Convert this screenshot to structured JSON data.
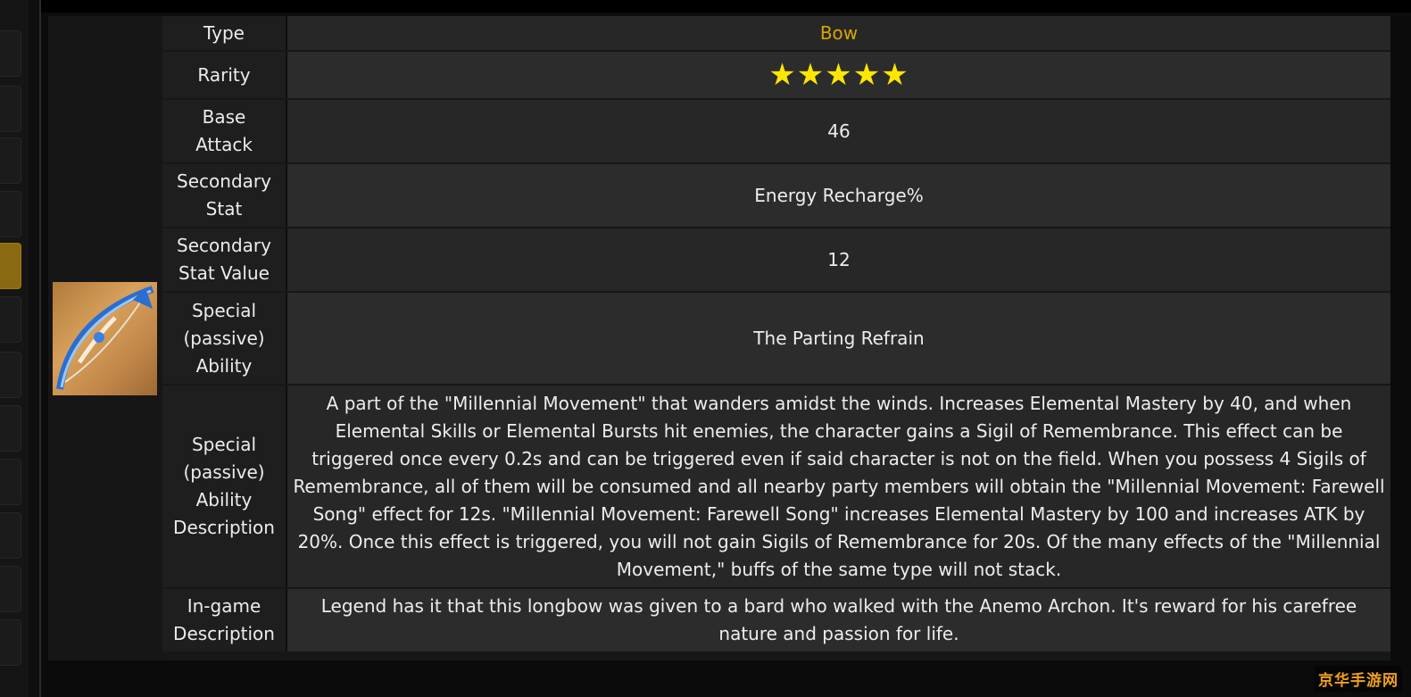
{
  "watermark": "京华手游网",
  "weapon": {
    "image_alt": "bow-icon"
  },
  "rows": [
    {
      "label": "Type",
      "value": "Bow"
    },
    {
      "label": "Rarity",
      "value": "★★★★★"
    },
    {
      "label": "Base\nAttack",
      "value": "46"
    },
    {
      "label": "Secondary\nStat",
      "value": "Energy Recharge%"
    },
    {
      "label": "Secondary\nStat Value",
      "value": "12"
    },
    {
      "label": "Special\n(passive)\nAbility",
      "value": "The Parting Refrain"
    },
    {
      "label": "Special\n(passive)\nAbility\nDescription",
      "value": "A part of the \"Millennial Movement\" that wanders amidst the winds. Increases Elemental Mastery by 40, and when Elemental Skills or Elemental Bursts hit enemies, the character gains a Sigil of Remembrance. This effect can be triggered once every 0.2s and can be triggered even if said character is not on the field. When you possess 4 Sigils of Remembrance, all of them will be consumed and all nearby party members will obtain the \"Millennial Movement: Farewell Song\" effect for 12s. \"Millennial Movement: Farewell Song\" increases Elemental Mastery by 100 and increases ATK by 20%. Once this effect is triggered, you will not gain Sigils of Remembrance for 20s. Of the many effects of the \"Millennial Movement,\" buffs of the same type will not stack."
    },
    {
      "label": "In-game\nDescription",
      "value": "Legend has it that this longbow was given to a bard who walked with the Anemo Archon. It's reward for his carefree nature and passion for life."
    }
  ],
  "rarity_stars": 5,
  "colors": {
    "type_value": "#d9a500",
    "star": "#ffe600",
    "sidebar_active": "#8a6a10"
  }
}
